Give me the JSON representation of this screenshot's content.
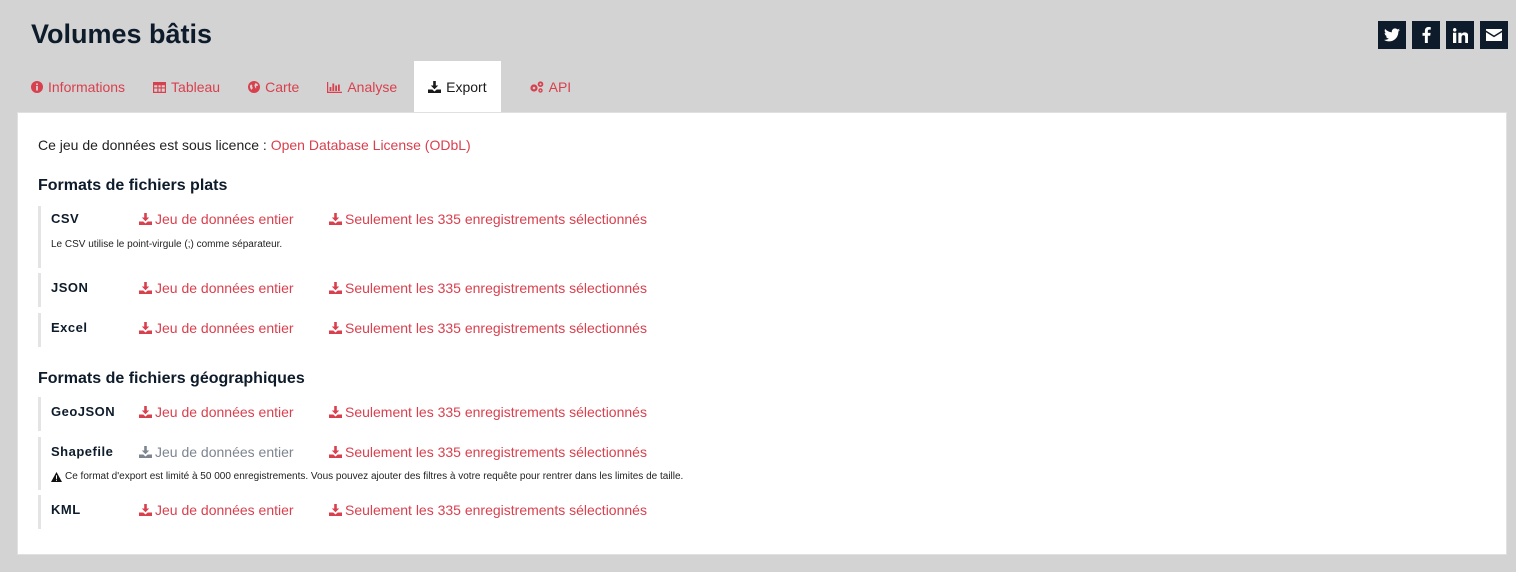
{
  "page": {
    "title": "Volumes bâtis"
  },
  "social": [
    {
      "name": "twitter",
      "icon": "twitter-icon"
    },
    {
      "name": "facebook",
      "icon": "facebook-icon"
    },
    {
      "name": "linkedin",
      "icon": "linkedin-icon"
    },
    {
      "name": "email",
      "icon": "envelope-icon"
    }
  ],
  "tabs": [
    {
      "label": "Informations",
      "icon": "info-circle-icon"
    },
    {
      "label": "Tableau",
      "icon": "table-icon"
    },
    {
      "label": "Carte",
      "icon": "globe-icon"
    },
    {
      "label": "Analyse",
      "icon": "bar-chart-icon"
    },
    {
      "label": "Export",
      "icon": "download-icon",
      "active": true
    },
    {
      "label": "API",
      "icon": "cogs-icon"
    }
  ],
  "licence": {
    "text": "Ce jeu de données est sous licence :",
    "link": "Open Database License (ODbL)"
  },
  "flat": {
    "heading": "Formats de fichiers plats",
    "formats": [
      {
        "name": "CSV",
        "full": "Jeu de données entier",
        "selected": "Seulement les 335 enregistrements sélectionnés",
        "note": "Le CSV utilise le point-virgule (;) comme séparateur."
      },
      {
        "name": "JSON",
        "full": "Jeu de données entier",
        "selected": "Seulement les 335 enregistrements sélectionnés"
      },
      {
        "name": "Excel",
        "full": "Jeu de données entier",
        "selected": "Seulement les 335 enregistrements sélectionnés"
      }
    ]
  },
  "geo": {
    "heading": "Formats de fichiers géographiques",
    "formats": [
      {
        "name": "GeoJSON",
        "full": "Jeu de données entier",
        "selected": "Seulement les 335 enregistrements sélectionnés"
      },
      {
        "name": "Shapefile",
        "full": "Jeu de données entier",
        "full_disabled": true,
        "selected": "Seulement les 335 enregistrements sélectionnés",
        "note": "Ce format d'export est limité à 50 000 enregistrements. Vous pouvez ajouter des filtres à votre requête pour rentrer dans les limites de taille."
      },
      {
        "name": "KML",
        "full": "Jeu de données entier",
        "selected": "Seulement les 335 enregistrements sélectionnés"
      }
    ]
  },
  "colors": {
    "accent": "#d9404e",
    "dark": "#0d1b2a",
    "disabled": "#7d8590",
    "background": "#d3d3d3"
  }
}
